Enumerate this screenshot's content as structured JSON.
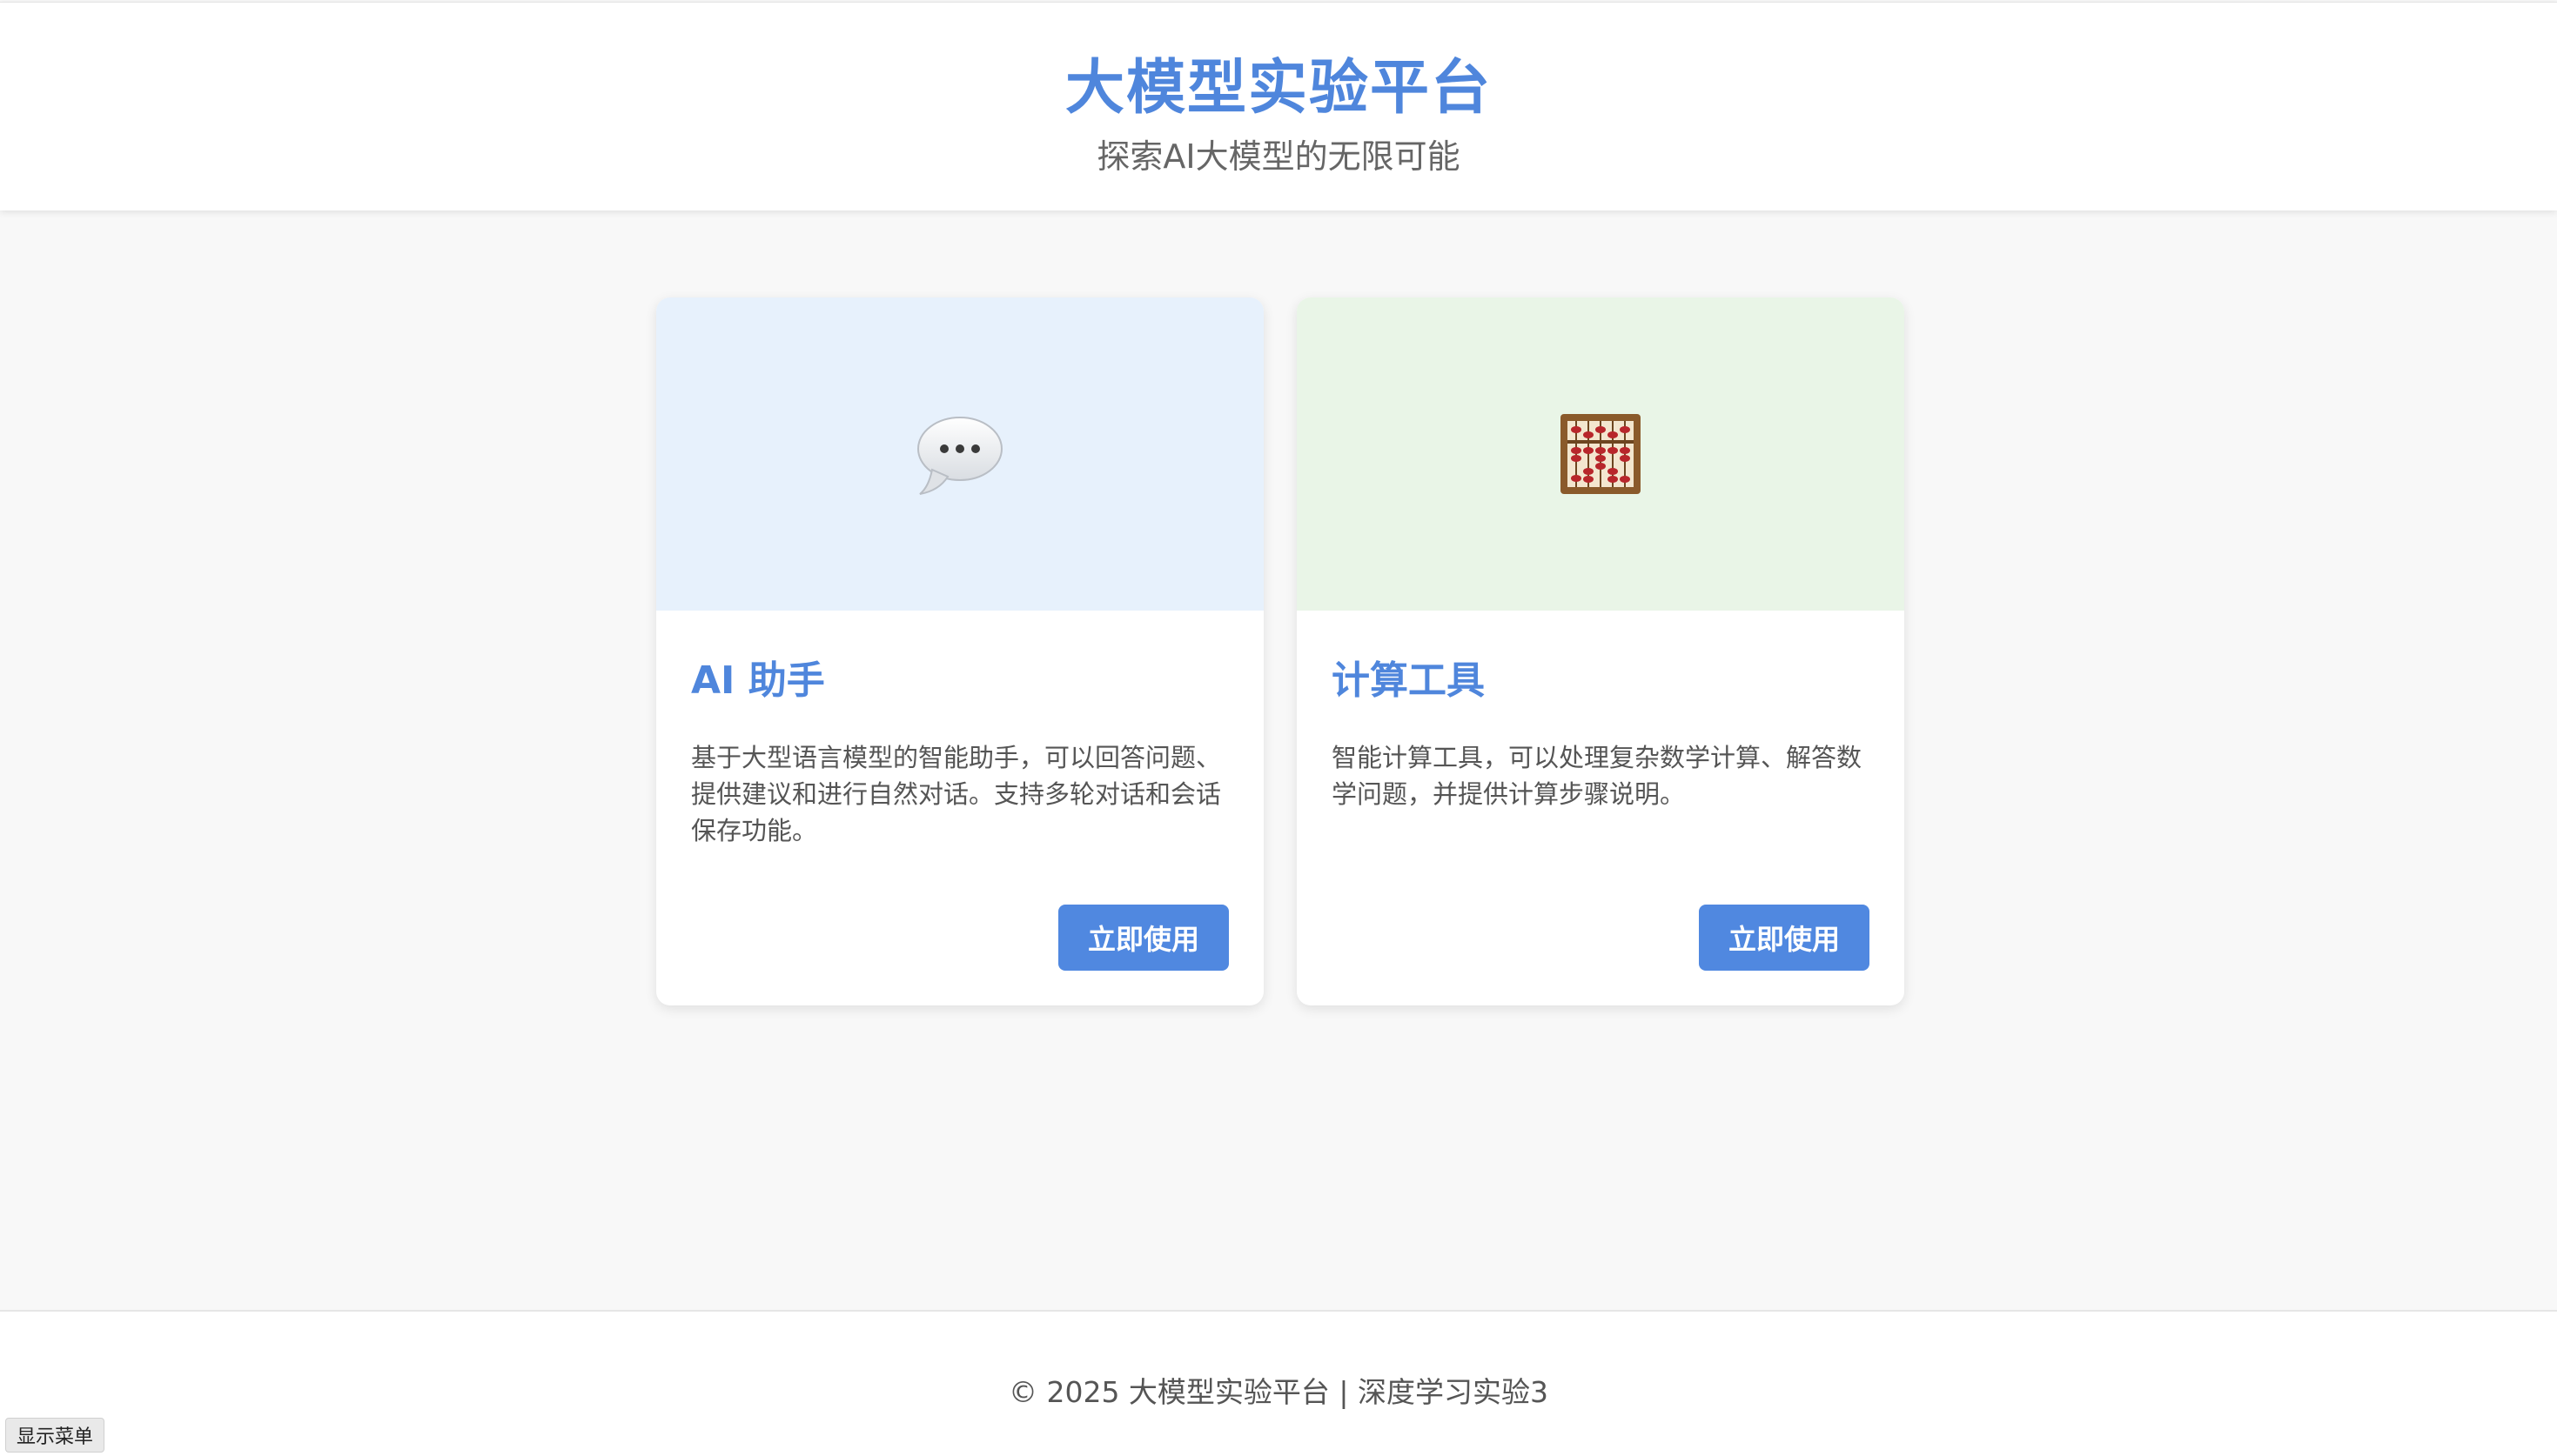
{
  "header": {
    "title": "大模型实验平台",
    "subtitle": "探索AI大模型的无限可能"
  },
  "cards": [
    {
      "icon": "speech-bubble-icon",
      "title": "AI 助手",
      "description": "基于大型语言模型的智能助手，可以回答问题、提供建议和进行自然对话。支持多轮对话和会话保存功能。",
      "button_label": "立即使用",
      "banner_color": "#e7f1fc"
    },
    {
      "icon": "abacus-icon",
      "title": "计算工具",
      "description": "智能计算工具，可以处理复杂数学计算、解答数学问题，并提供计算步骤说明。",
      "button_label": "立即使用",
      "banner_color": "#e9f5e7"
    }
  ],
  "footer": {
    "copyright": "© 2025 大模型实验平台 | 深度学习实验3"
  },
  "menu_toggle_label": "显示菜单",
  "colors": {
    "accent": "#4f86dc",
    "button": "#5088e0",
    "background": "#f8f8f8"
  }
}
